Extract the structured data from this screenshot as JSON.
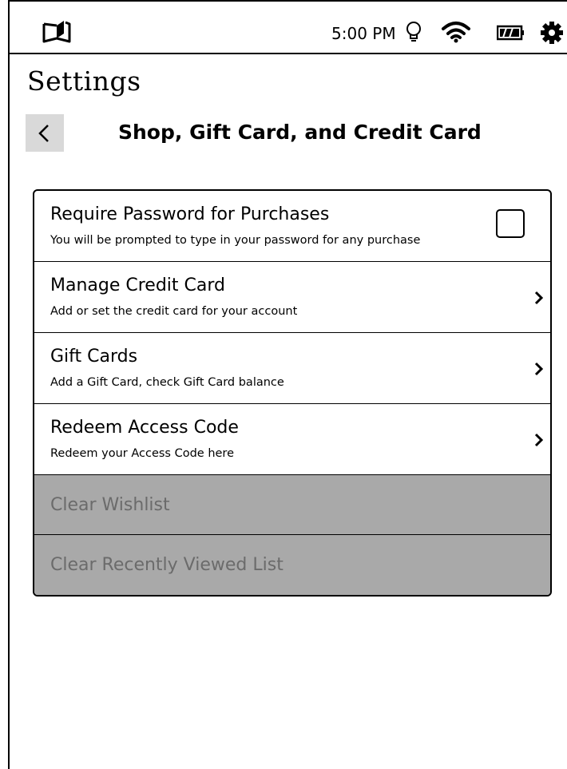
{
  "status_bar": {
    "time": "5:00 PM",
    "icons": [
      "book-icon",
      "light-bulb-icon",
      "wifi-icon",
      "battery-icon",
      "gear-icon"
    ]
  },
  "header": {
    "title": "Settings",
    "section_title": "Shop, Gift Card, and Credit Card"
  },
  "settings": {
    "items": [
      {
        "title": "Require Password for Purchases",
        "subtitle": "You will be prompted to type in your password for any purchase",
        "control": "checkbox",
        "checked": false
      },
      {
        "title": "Manage Credit Card",
        "subtitle": "Add or set the credit card for your account",
        "control": "chevron"
      },
      {
        "title": "Gift Cards",
        "subtitle": "Add a Gift Card, check Gift Card balance",
        "control": "chevron"
      },
      {
        "title": "Redeem Access Code",
        "subtitle": "Redeem your Access Code here",
        "control": "chevron"
      },
      {
        "title": "Clear Wishlist",
        "disabled": true
      },
      {
        "title": "Clear Recently Viewed List",
        "disabled": true
      }
    ]
  },
  "colors": {
    "disabled_background": "#a9a9a9",
    "disabled_text": "#6b6b6b",
    "back_button_background": "#d9d9d9"
  }
}
